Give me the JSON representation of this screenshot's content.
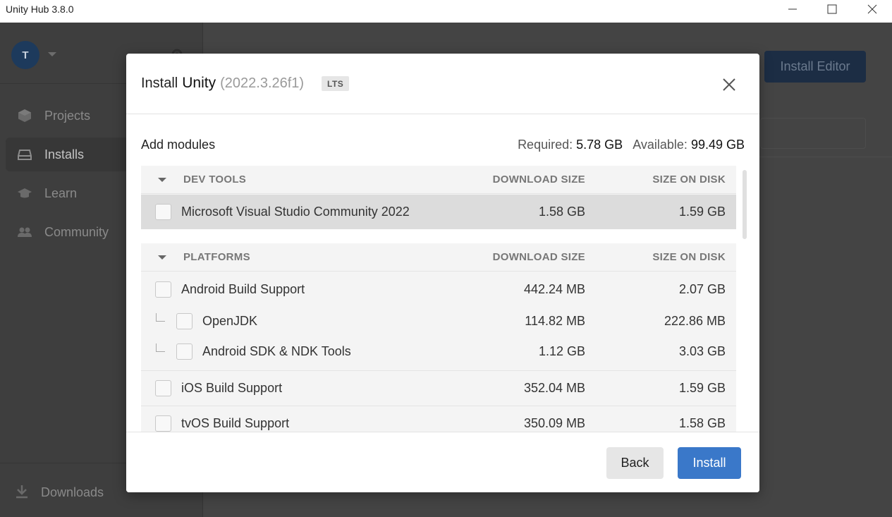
{
  "window": {
    "title": "Unity Hub 3.8.0",
    "controls": [
      "minimize-icon",
      "maximize-icon",
      "close-icon"
    ]
  },
  "sidebar": {
    "avatar_initial": "T",
    "items": [
      {
        "label": "Projects",
        "icon": "cube-icon",
        "active": false
      },
      {
        "label": "Installs",
        "icon": "drive-icon",
        "active": true
      },
      {
        "label": "Learn",
        "icon": "graduation-cap-icon",
        "active": false
      },
      {
        "label": "Community",
        "icon": "people-icon",
        "active": false
      }
    ],
    "downloads_label": "Downloads"
  },
  "main": {
    "install_editor_label": "Install Editor"
  },
  "modal": {
    "title_prefix": "Install",
    "title_product": "Unity",
    "version": "(2022.3.26f1)",
    "badge": "LTS",
    "add_modules_label": "Add modules",
    "required_label": "Required:",
    "required_value": "5.78 GB",
    "available_label": "Available:",
    "available_value": "99.49 GB",
    "sections": [
      {
        "name": "DEV TOOLS",
        "col_download": "DOWNLOAD SIZE",
        "col_disk": "SIZE ON DISK",
        "rows": [
          {
            "name": "Microsoft Visual Studio Community 2022",
            "download": "1.58 GB",
            "disk": "1.59 GB",
            "checked": false
          }
        ]
      },
      {
        "name": "PLATFORMS",
        "col_download": "DOWNLOAD SIZE",
        "col_disk": "SIZE ON DISK",
        "rows": [
          {
            "name": "Android Build Support",
            "download": "442.24 MB",
            "disk": "2.07 GB",
            "checked": false
          },
          {
            "name": "OpenJDK",
            "download": "114.82 MB",
            "disk": "222.86 MB",
            "checked": false,
            "child": true
          },
          {
            "name": "Android SDK & NDK Tools",
            "download": "1.12 GB",
            "disk": "3.03 GB",
            "checked": false,
            "child": true
          },
          {
            "name": "iOS Build Support",
            "download": "352.04 MB",
            "disk": "1.59 GB",
            "checked": false
          },
          {
            "name": "tvOS Build Support",
            "download": "350.09 MB",
            "disk": "1.58 GB",
            "checked": false
          }
        ]
      }
    ],
    "back_label": "Back",
    "install_label": "Install"
  },
  "colors": {
    "accent": "#3a78c9",
    "install_editor_bg": "#1c2d44",
    "overlay": "#444444",
    "row_highlight": "#dcdcdc"
  }
}
